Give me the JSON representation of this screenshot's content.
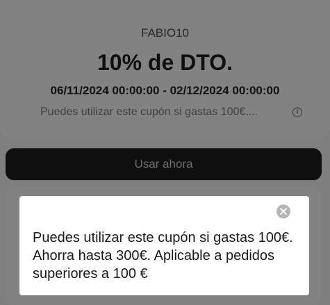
{
  "coupon": {
    "code": "FABIO10",
    "discount": "10% de DTO.",
    "dates": "06/11/2024 00:00:00 - 02/12/2024 00:00:00",
    "condition_short": "Puedes utilizar este cupón si gastas 100€....",
    "info_icon": "info-icon"
  },
  "actions": {
    "use_now": "Usar ahora"
  },
  "tooltip": {
    "text": "Puedes utilizar este cupón si gastas 100€. Ahorra hasta 300€. Aplicable a pedidos superiores a 100 €",
    "close_icon": "close-icon"
  },
  "colors": {
    "overlay_background": "#7f7f7f",
    "button_background": "#0f0f0f",
    "tooltip_background": "#ffffff",
    "close_button": "#b5b5b5"
  }
}
